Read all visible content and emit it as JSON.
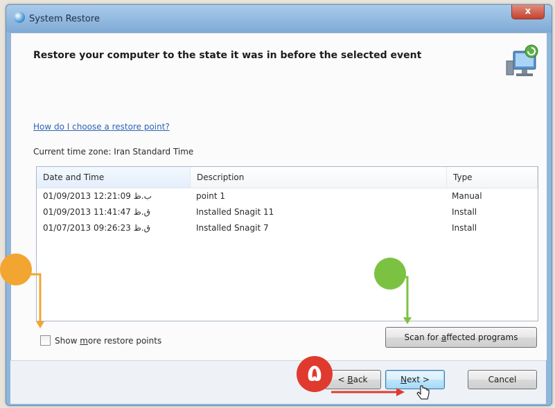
{
  "window": {
    "title": "System Restore",
    "close_label": "x"
  },
  "header": {
    "title": "Restore your computer to the state it was in before the selected event"
  },
  "help_link": "How do I choose a restore point?",
  "timezone": "Current time zone: Iran Standard Time",
  "list": {
    "columns": [
      "Date and Time",
      "Description",
      "Type"
    ],
    "rows": [
      {
        "date": "01/09/2013 12:21:09 ب.ظ",
        "description": "point 1",
        "type": "Manual"
      },
      {
        "date": "01/09/2013 11:41:47 ق.ظ",
        "description": "Installed Snagit 11",
        "type": "Install"
      },
      {
        "date": "01/07/2013 09:26:23 ق.ظ",
        "description": "Installed Snagit 7",
        "type": "Install"
      }
    ]
  },
  "show_more": {
    "label_pre": "Show ",
    "label_accel": "m",
    "label_post": "ore restore points",
    "checked": false
  },
  "scan_button": {
    "label_pre": "Scan for ",
    "label_accel": "a",
    "label_post": "ffected programs"
  },
  "buttons": {
    "back_pre": "< ",
    "back_accel": "B",
    "back_post": "ack",
    "next_accel": "N",
    "next_post": "ext >",
    "cancel": "Cancel"
  },
  "annotations": {
    "step_number": "۵",
    "orange": "#f2a530",
    "green": "#7cc242",
    "red": "#e03a2f"
  }
}
